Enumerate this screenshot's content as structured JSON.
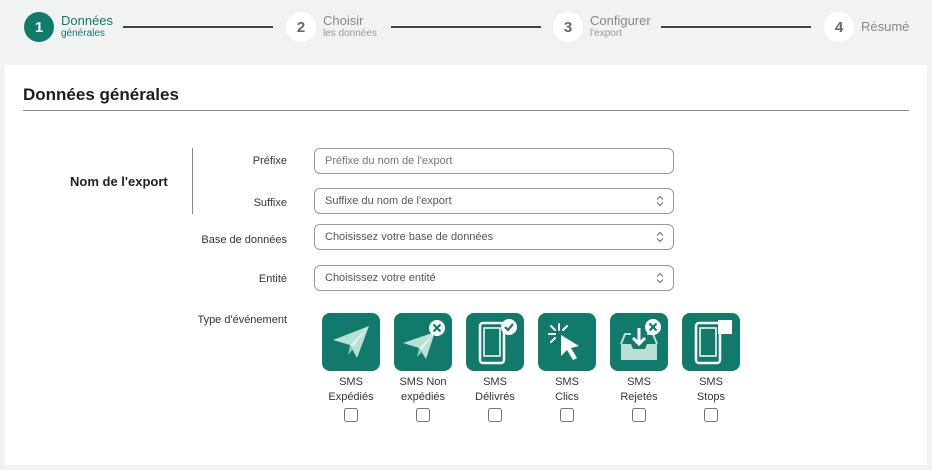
{
  "stepper": {
    "steps": [
      {
        "number": "1",
        "title": "Données",
        "subtitle": "générales",
        "active": true
      },
      {
        "number": "2",
        "title": "Choisir",
        "subtitle": "les données",
        "active": false
      },
      {
        "number": "3",
        "title": "Configurer",
        "subtitle": "l'export",
        "active": false
      },
      {
        "number": "4",
        "title": "Résumé",
        "subtitle": "",
        "active": false
      }
    ]
  },
  "section": {
    "title": "Données générales",
    "group_label": "Nom de l'export"
  },
  "form": {
    "prefix": {
      "label": "Préfixe",
      "placeholder": "Préfixe du nom de l'export"
    },
    "suffix": {
      "label": "Suffixe",
      "value": "Suffixe du nom de l'export"
    },
    "database": {
      "label": "Base de données",
      "value": "Choisissez votre base de données"
    },
    "entity": {
      "label": "Entité",
      "value": "Choisissez votre entité"
    },
    "event_type_label": "Type d'événement"
  },
  "events": [
    {
      "line1": "SMS",
      "line2": "Expédiés",
      "icon": "paper-plane-icon",
      "checked": false
    },
    {
      "line1": "SMS Non",
      "line2": "expédiés",
      "icon": "paper-plane-x-icon",
      "checked": false
    },
    {
      "line1": "SMS",
      "line2": "Délivrés",
      "icon": "phone-check-icon",
      "checked": false
    },
    {
      "line1": "SMS",
      "line2": "Clics",
      "icon": "cursor-click-icon",
      "checked": false
    },
    {
      "line1": "SMS",
      "line2": "Rejetés",
      "icon": "inbox-x-icon",
      "checked": false
    },
    {
      "line1": "SMS",
      "line2": "Stops",
      "icon": "phone-stop-icon",
      "checked": false
    }
  ],
  "colors": {
    "accent": "#127a6b",
    "background": "#f1f2f2",
    "card": "#ffffff"
  }
}
